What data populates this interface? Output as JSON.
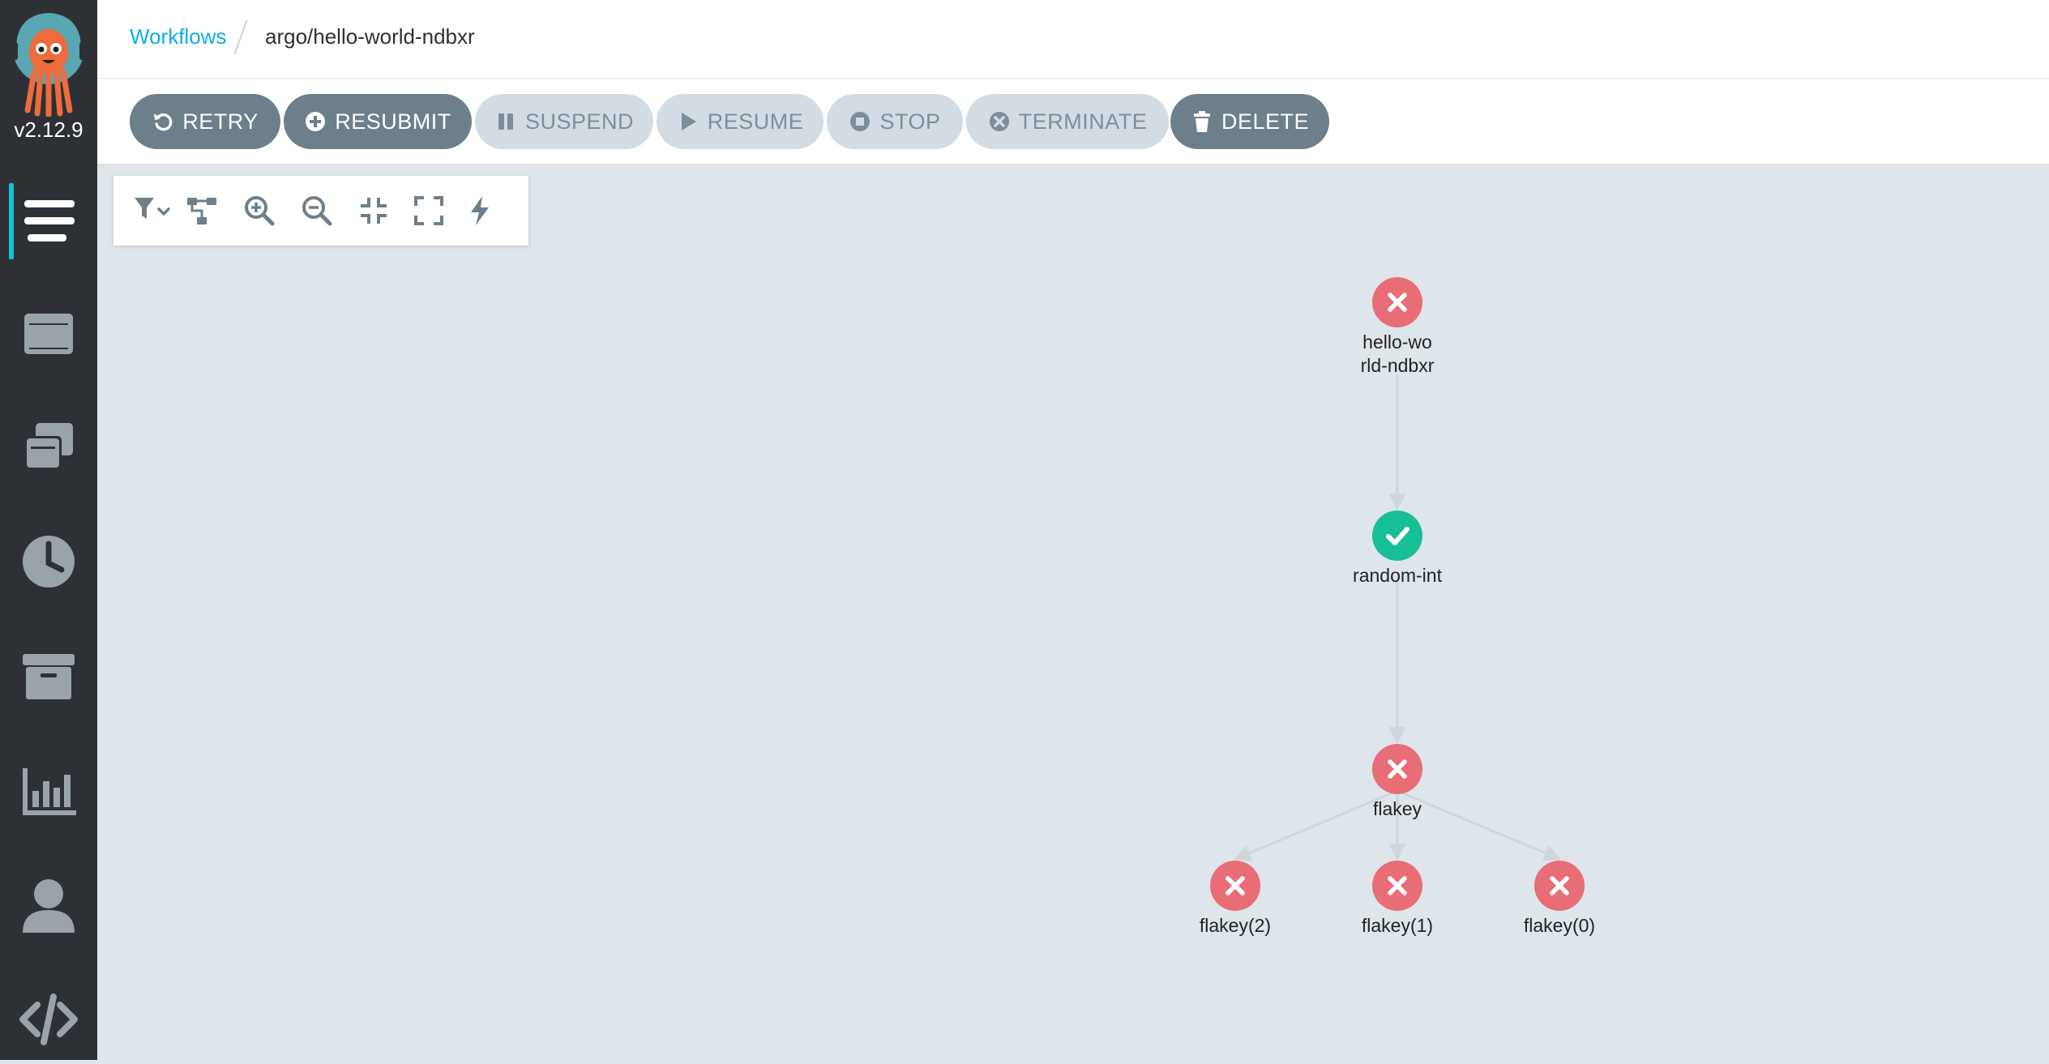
{
  "app": {
    "version": "v2.12.9"
  },
  "sidebar": {
    "items": [
      {
        "icon": "workflows-icon",
        "active": true
      },
      {
        "icon": "workflow-templates-icon"
      },
      {
        "icon": "cluster-workflow-templates-icon"
      },
      {
        "icon": "cron-workflows-icon"
      },
      {
        "icon": "archived-workflows-icon"
      },
      {
        "icon": "reports-icon"
      },
      {
        "icon": "user-icon"
      },
      {
        "icon": "api-docs-icon"
      }
    ]
  },
  "breadcrumb": {
    "parent": "Workflows",
    "current": "argo/hello-world-ndbxr"
  },
  "toolbar": {
    "buttons": [
      {
        "label": "RETRY",
        "icon": "retry-icon",
        "enabled": true
      },
      {
        "label": "RESUBMIT",
        "icon": "plus-circle-icon",
        "enabled": true
      },
      {
        "label": "SUSPEND",
        "icon": "pause-icon",
        "enabled": false
      },
      {
        "label": "RESUME",
        "icon": "play-icon",
        "enabled": false
      },
      {
        "label": "STOP",
        "icon": "stop-circle-icon",
        "enabled": false
      },
      {
        "label": "TERMINATE",
        "icon": "times-circle-icon",
        "enabled": false
      },
      {
        "label": "DELETE",
        "icon": "trash-icon",
        "enabled": true
      }
    ]
  },
  "graph_toolbar": {
    "icons": [
      "filter-icon",
      "layout-icon",
      "zoom-in-icon",
      "zoom-out-icon",
      "collapse-icon",
      "expand-icon",
      "fast-icon"
    ]
  },
  "graph": {
    "nodes": [
      {
        "id": "root",
        "label_lines": [
          "hello-wo",
          "rld-ndbxr"
        ],
        "status": "failed"
      },
      {
        "id": "random-int",
        "label_lines": [
          "random-int"
        ],
        "status": "succeeded"
      },
      {
        "id": "flakey",
        "label_lines": [
          "flakey"
        ],
        "status": "failed"
      },
      {
        "id": "flakey2",
        "label_lines": [
          "flakey(2)"
        ],
        "status": "failed"
      },
      {
        "id": "flakey1",
        "label_lines": [
          "flakey(1)"
        ],
        "status": "failed"
      },
      {
        "id": "flakey0",
        "label_lines": [
          "flakey(0)"
        ],
        "status": "failed"
      }
    ],
    "edges": [
      [
        "root",
        "random-int"
      ],
      [
        "random-int",
        "flakey"
      ],
      [
        "flakey",
        "flakey2"
      ],
      [
        "flakey",
        "flakey1"
      ],
      [
        "flakey",
        "flakey0"
      ]
    ]
  },
  "colors": {
    "failed": "#e96d76",
    "succeeded": "#18be94",
    "accent": "#0dadea",
    "edge": "#cfd7dc"
  }
}
